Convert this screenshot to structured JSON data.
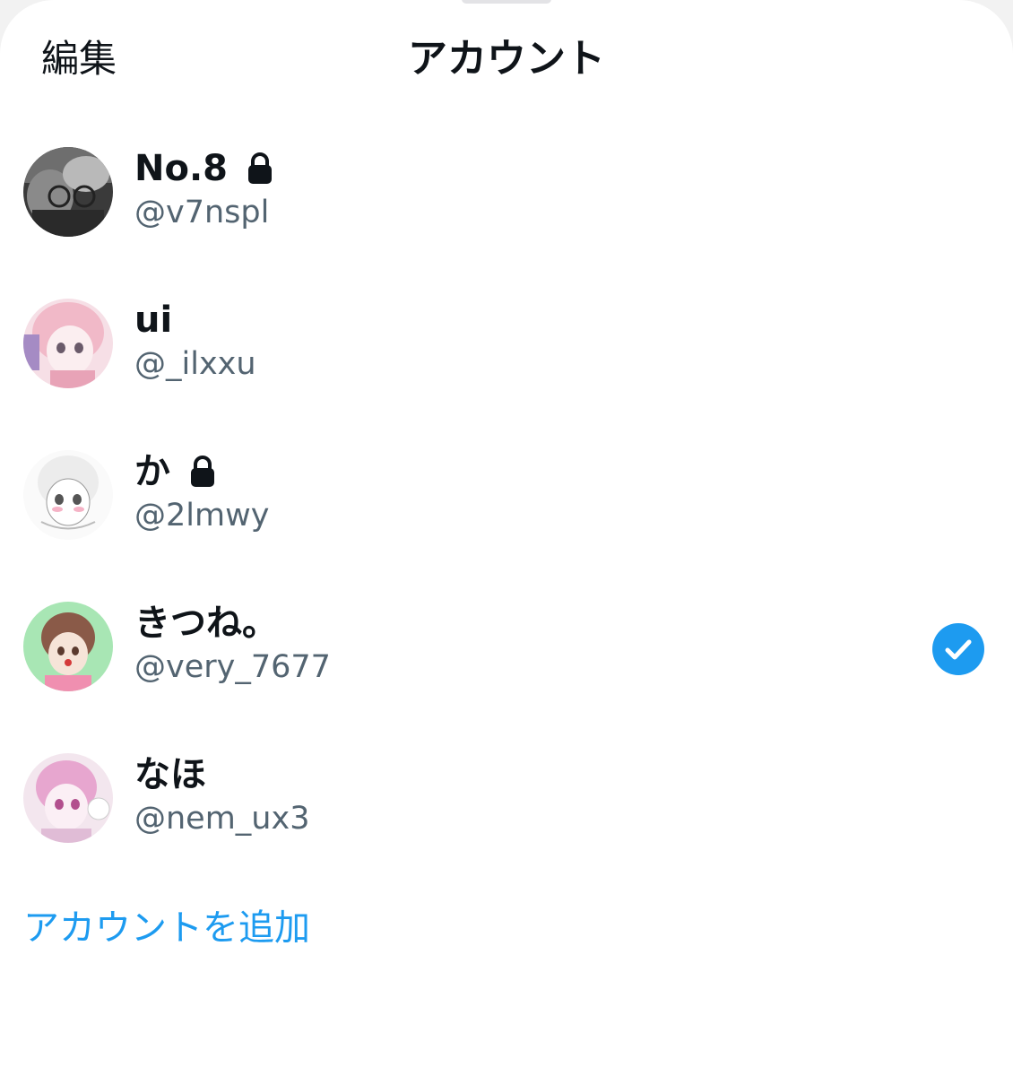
{
  "header": {
    "edit_label": "編集",
    "title": "アカウント"
  },
  "accounts": [
    {
      "name": "No.8",
      "handle": "@v7nspl",
      "locked": true,
      "selected": false
    },
    {
      "name": "ui",
      "handle": "@_ilxxu",
      "locked": false,
      "selected": false
    },
    {
      "name": "か",
      "handle": "@2lmwy",
      "locked": true,
      "selected": false
    },
    {
      "name": "きつね。",
      "handle": "@very_7677",
      "locked": false,
      "selected": true
    },
    {
      "name": "なほ",
      "handle": "@nem_ux3",
      "locked": false,
      "selected": false
    }
  ],
  "add_account_label": "アカウントを追加",
  "colors": {
    "accent": "#1d9bf0",
    "text_primary": "#0f1419",
    "text_secondary": "#536471"
  },
  "icons": {
    "lock": "lock-icon",
    "selected": "check-circle-icon"
  }
}
